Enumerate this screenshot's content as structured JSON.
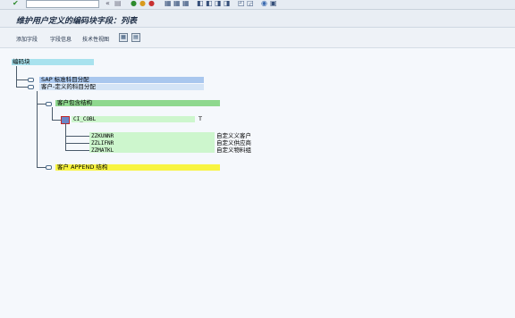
{
  "window": {
    "title": "维护用户定义的编码块字段：列表",
    "command_field_value": ""
  },
  "toolbar": {
    "add_field_label": "添加字段",
    "field_info_label": "字段信息",
    "tech_view_label": "技术性视图"
  },
  "tree": {
    "root_label": "编码块",
    "sap_std_label": "SAP 标准科目分配",
    "customer_def_label": "客户-定义的科目分配",
    "customer_incl_label": "客户包含结构",
    "ci_cobl_label": "CI_COBL",
    "ci_cobl_flag": "T",
    "fields": [
      {
        "name": "ZZKUNNR",
        "desc": "自定义义客户"
      },
      {
        "name": "ZZLIFNR",
        "desc": "自定义供应商"
      },
      {
        "name": "ZZMATKL",
        "desc": "自定义物料组"
      }
    ],
    "append_label": "客户 APPEND 结构"
  },
  "colors": {
    "root_highlight": "#a8e2ee",
    "sap_std_highlight": "#a9c7ee",
    "customer_def_highlight": "#d4e4f6",
    "incl_highlight": "#8ed88e",
    "field_highlight": "#cdf6cd",
    "append_highlight": "#f8f440"
  }
}
